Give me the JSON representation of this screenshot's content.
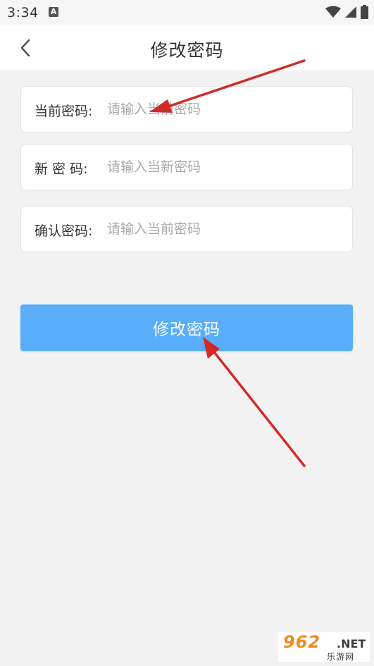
{
  "status": {
    "time": "3:34",
    "notification": "A"
  },
  "header": {
    "title": "修改密码"
  },
  "form": {
    "current": {
      "label": "当前密码:",
      "placeholder": "请输入当前密码"
    },
    "new": {
      "label": "新 密 码:",
      "placeholder": "请输入当新密码"
    },
    "confirm": {
      "label": "确认密码:",
      "placeholder": "请输入当前密码"
    }
  },
  "submit": {
    "label": "修改密码"
  },
  "watermark": {
    "number": "962",
    "suffix": ".NET",
    "text": "乐游网"
  },
  "icons": {
    "back": "back-arrow-icon",
    "wifi": "wifi-icon",
    "signal": "signal-icon",
    "battery": "battery-icon"
  },
  "colors": {
    "button": "#5aaef9",
    "annotation_arrow": "#d12a2a",
    "watermark_orange": "#f28a1e"
  }
}
